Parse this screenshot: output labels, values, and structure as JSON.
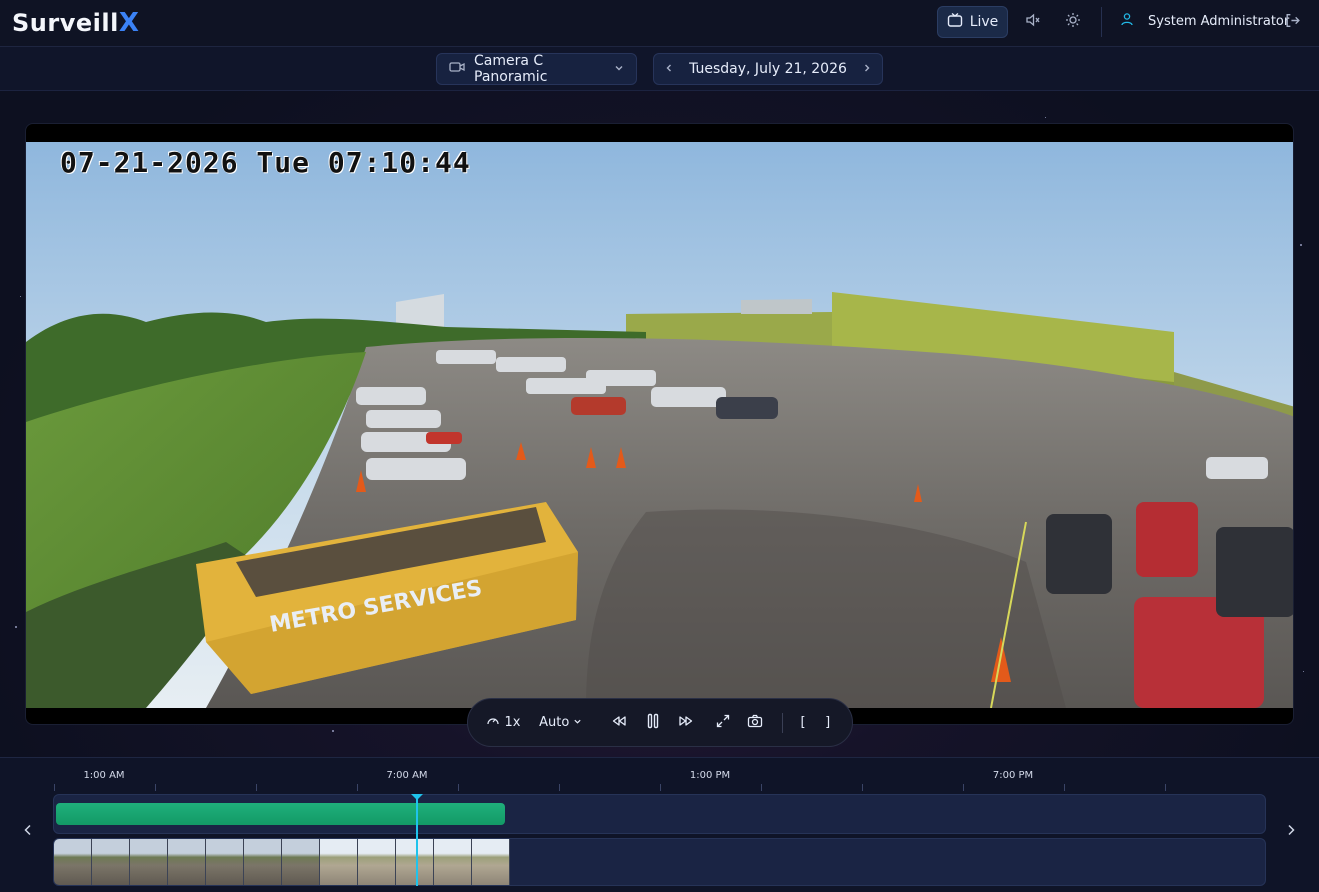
{
  "app": {
    "logo_text": "Surveill",
    "logo_accent": "X",
    "accent_color": "#3b82f6"
  },
  "header": {
    "live_label": "Live",
    "user_name": "System Administrator",
    "icons": [
      "tv-icon",
      "mute-icon",
      "brightness-icon",
      "user-icon",
      "logout-icon"
    ]
  },
  "subbar": {
    "camera_name": "Camera C Panoramic",
    "date": "Tuesday, July 21, 2026"
  },
  "video": {
    "overlay_timestamp": "07-21-2026 Tue 07:10:44",
    "dumpster_text": "METRO SERVICES"
  },
  "controls": {
    "speed_label": "1x",
    "quality_label": "Auto",
    "clip_start_label": "[",
    "clip_end_label": "]"
  },
  "timeline": {
    "tick_labels": [
      "1:00 AM",
      "7:00 AM",
      "1:00 PM",
      "7:00 PM"
    ],
    "recording_color": "#1fb07c",
    "playhead_color": "#1fc3ec",
    "recorded_fraction_of_day": 0.37,
    "playhead_time": "07:10:44"
  }
}
